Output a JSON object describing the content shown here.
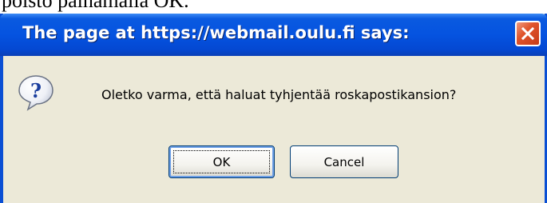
{
  "background": {
    "text": "poisto painamalla OK."
  },
  "dialog": {
    "title": "The page at https://webmail.oulu.fi says:",
    "message": "Oletko varma, että haluat tyhjentää roskapostikansion?",
    "icon": "question-icon",
    "close_icon": "close-icon",
    "buttons": {
      "ok_label": "OK",
      "cancel_label": "Cancel"
    }
  },
  "colors": {
    "titlebar": "#0553e0",
    "body": "#ece9d8",
    "close": "#e0542b",
    "button_border": "#003c74"
  }
}
